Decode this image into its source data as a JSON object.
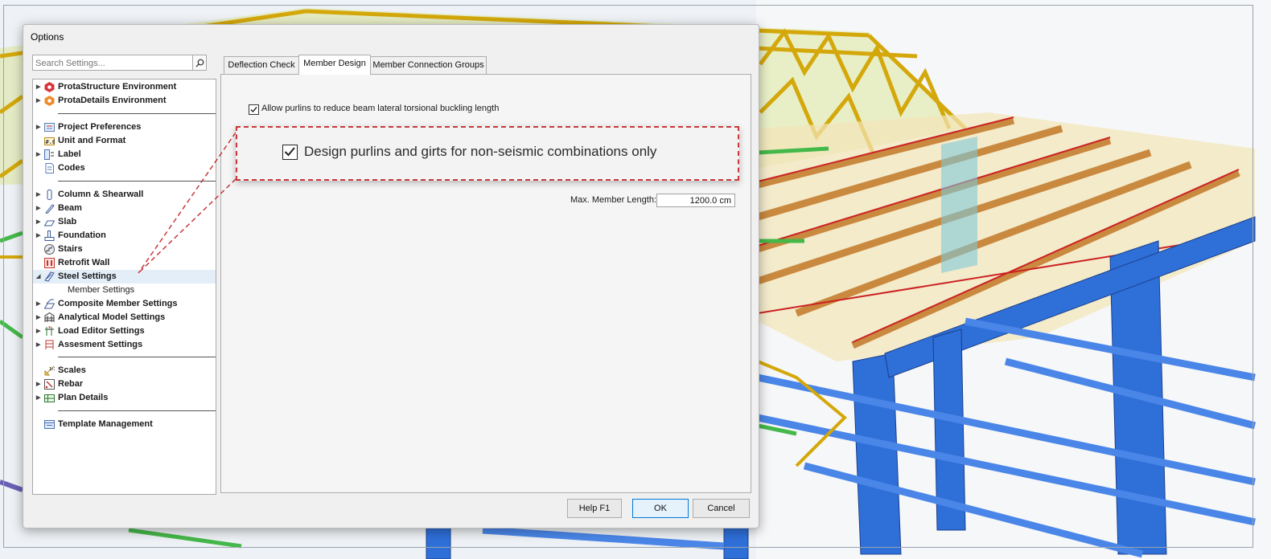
{
  "dialog": {
    "title": "Options"
  },
  "search": {
    "placeholder": "Search Settings..."
  },
  "tree": {
    "items": [
      {
        "label": "ProtaStructure Environment"
      },
      {
        "label": "ProtaDetails Environment"
      },
      {
        "label": "Project Preferences"
      },
      {
        "label": "Unit and Format"
      },
      {
        "label": "Label"
      },
      {
        "label": "Codes"
      },
      {
        "label": "Column & Shearwall"
      },
      {
        "label": "Beam"
      },
      {
        "label": "Slab"
      },
      {
        "label": "Foundation"
      },
      {
        "label": "Stairs"
      },
      {
        "label": "Retrofit Wall"
      },
      {
        "label": "Steel Settings"
      },
      {
        "label": "Member Settings"
      },
      {
        "label": "Composite Member Settings"
      },
      {
        "label": "Analytical Model Settings"
      },
      {
        "label": "Load Editor Settings"
      },
      {
        "label": "Assesment Settings"
      },
      {
        "label": "Scales"
      },
      {
        "label": "Rebar"
      },
      {
        "label": "Plan Details"
      },
      {
        "label": "Template Management"
      }
    ]
  },
  "tabs": [
    {
      "label": "Deflection Check"
    },
    {
      "label": "Member Design"
    },
    {
      "label": "Member Connection Groups"
    }
  ],
  "panel": {
    "option1": {
      "label": "Allow purlins to reduce beam lateral torsional buckling length",
      "checked": true
    },
    "max_member_length": {
      "label": "Max. Member Length:",
      "value": "1200.0 cm"
    }
  },
  "callout": {
    "label": "Design purlins and girts for non-seismic combinations only",
    "checked": true
  },
  "buttons": {
    "help": "Help  F1",
    "ok": "OK",
    "cancel": "Cancel"
  },
  "colors": {
    "accent": "#0078d7",
    "callout_border": "#c8383a",
    "selection": "#e3eef9"
  }
}
